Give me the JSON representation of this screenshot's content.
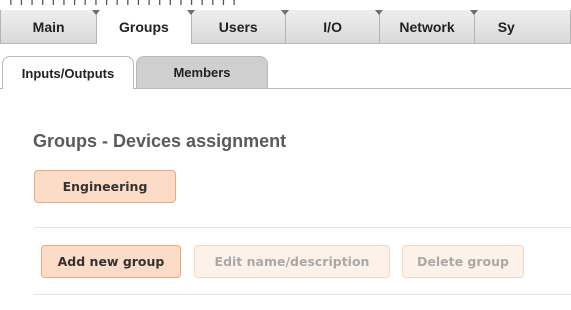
{
  "main_tabs": [
    {
      "label": "Main",
      "active": false
    },
    {
      "label": "Groups",
      "active": true
    },
    {
      "label": "Users",
      "active": false
    },
    {
      "label": "I/O",
      "active": false
    },
    {
      "label": "Network",
      "active": false
    },
    {
      "label": "Sy",
      "active": false
    }
  ],
  "sub_tabs": [
    {
      "label": "Inputs/Outputs",
      "active": true
    },
    {
      "label": "Members",
      "active": false
    }
  ],
  "page": {
    "title": "Groups - Devices assignment",
    "group_button": "Engineering"
  },
  "actions": {
    "add_label": "Add new group",
    "edit_label": "Edit name/description",
    "delete_label": "Delete group"
  },
  "colors": {
    "accent_fill": "#fcdcc7",
    "accent_border": "#eea87d",
    "disabled_fill": "#fdf2ea",
    "disabled_text": "#a9a9a9"
  }
}
